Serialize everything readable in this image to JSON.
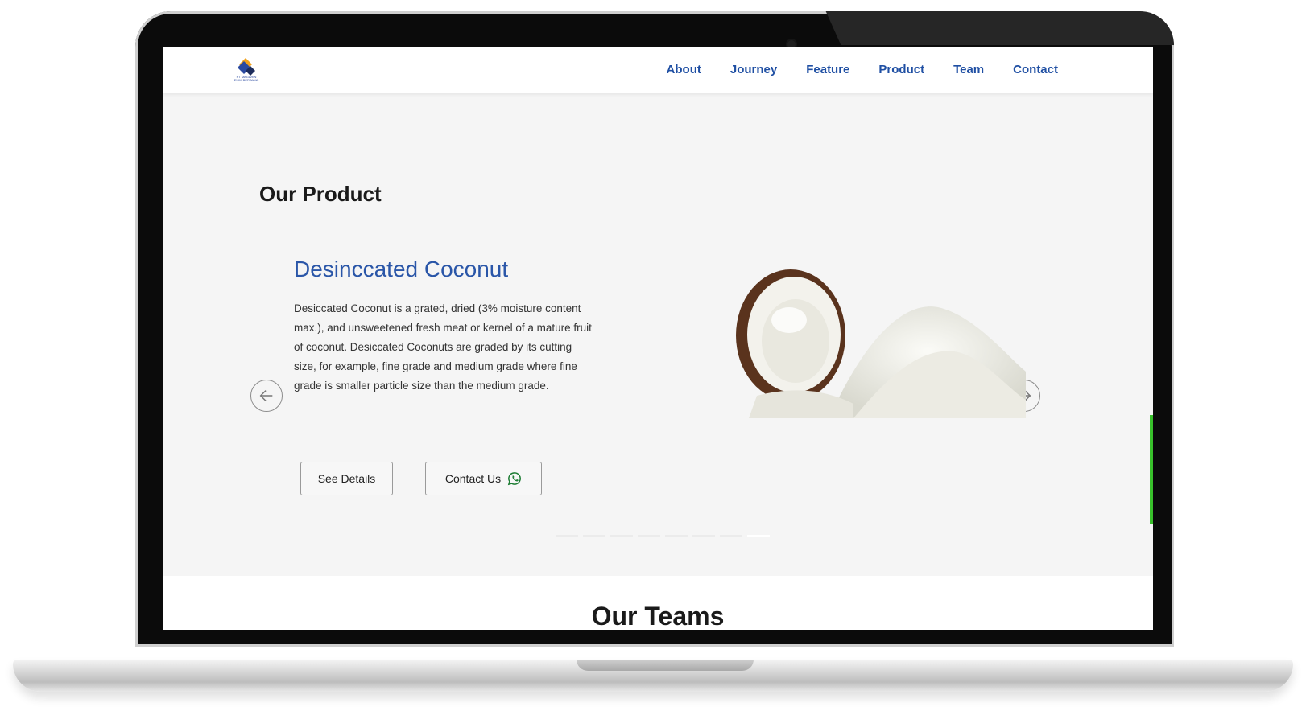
{
  "nav": {
    "logo_text_line1": "PT MAGARIN",
    "logo_text_line2": "EXIM BERSAMA",
    "links": [
      "About",
      "Journey",
      "Feature",
      "Product",
      "Team",
      "Contact"
    ]
  },
  "product_section": {
    "title": "Our Product",
    "product": {
      "name": "Desinccated Coconut",
      "description": "Desiccated Coconut is a grated, dried (3% moisture content max.), and unsweetened fresh meat or kernel of a mature fruit of coconut. Desiccated Coconuts are graded by its cutting size, for example, fine grade and medium grade where fine grade is smaller particle size than the medium grade.",
      "image": "coconut-and-desiccated-coconut-photo"
    },
    "buttons": {
      "details_label": "See Details",
      "contact_label": "Contact Us",
      "contact_icon": "whatsapp-icon"
    },
    "carousel": {
      "prev_icon": "arrow-left-icon",
      "next_icon": "arrow-right-icon",
      "slide_count": 8,
      "active_slide": 8
    }
  },
  "teams_section": {
    "title": "Our Teams"
  },
  "colors": {
    "nav_link": "#1f4fa3",
    "product_name": "#2a56a8",
    "section_bg": "#f5f5f5",
    "scroll_indicator": "#38c12b",
    "whatsapp": "#1e7d34"
  }
}
